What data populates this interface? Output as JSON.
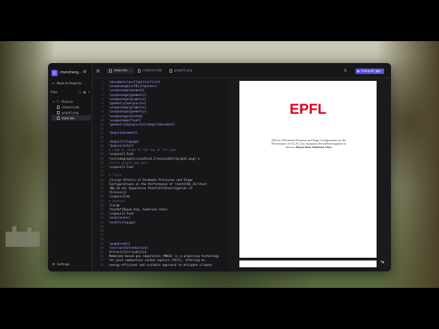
{
  "sidebar": {
    "project_initial": "c",
    "project_name": "chenzheng...",
    "back_label": "Back to Projects",
    "files_label": "Files",
    "tree": [
      {
        "label": "Pictures",
        "type": "folder",
        "indent": false,
        "active": false
      },
      {
        "label": "citations.bib",
        "type": "file",
        "indent": true,
        "active": false
      },
      {
        "label": "graph1.png",
        "type": "file",
        "indent": true,
        "active": false
      },
      {
        "label": "main.tex",
        "type": "file",
        "indent": true,
        "active": true
      }
    ],
    "settings_label": "Settings"
  },
  "tabs": [
    {
      "label": "main.tex",
      "active": true
    },
    {
      "label": "citations.bib",
      "active": false
    },
    {
      "label": "graph1.png",
      "active": false
    }
  ],
  "toolbar": {
    "compile_label": "Compile",
    "compile_shortcut": "⌘S"
  },
  "editor": {
    "lines": [
      {
        "n": "1",
        "text": "\\documentclass[12pt]{article}",
        "kind": "kw"
      },
      {
        "n": "2",
        "text": "\\usepackage[utf8]{inputenc}",
        "kind": "kw"
      },
      {
        "n": "3",
        "text": "\\usepackage{amsmath}",
        "kind": "kw"
      },
      {
        "n": "4",
        "text": "\\usepackage{geometry}",
        "kind": "kw"
      },
      {
        "n": "5",
        "text": "\\usepackage{graphicx}",
        "kind": "kw"
      },
      {
        "n": "6",
        "text": "\\geometry{margin=1in}",
        "kind": "kw"
      },
      {
        "n": "7",
        "text": "\\usepackage{graphicx}",
        "kind": "kw"
      },
      {
        "n": "8",
        "text": "\\usepackage{geometry}",
        "kind": "kw"
      },
      {
        "n": "9",
        "text": "\\usepackage{minted}",
        "kind": "kw"
      },
      {
        "n": "10",
        "text": "\\usepackage{float}",
        "kind": "kw"
      },
      {
        "n": "11",
        "text": "\\geometry{margin=1in}\\begin{document}",
        "kind": "kw"
      },
      {
        "n": "12",
        "text": "",
        "kind": "plain"
      },
      {
        "n": "13",
        "text": "\\begin{document}",
        "kind": "kw"
      },
      {
        "n": "14",
        "text": "",
        "kind": "plain"
      },
      {
        "n": "15",
        "text": "\\begin{titlepage}",
        "kind": "kw"
      },
      {
        "n": "16",
        "text": "    \\begin{center}",
        "kind": "kw"
      },
      {
        "n": "17",
        "text": "        % Logo or image at the top of the page",
        "kind": "cmt"
      },
      {
        "n": "18",
        "text": "        \\vspace{1.5cm}",
        "kind": "plain"
      },
      {
        "n": "19",
        "text": "        \\includegraphics[width=0.5\\textwidth]{graph1.png} %",
        "kind": "plain"
      },
      {
        "n": "20",
        "text": "        insert graph1.png here",
        "kind": "cmt"
      },
      {
        "n": "21",
        "text": "        \\vspace{1.5cm}",
        "kind": "plain"
      },
      {
        "n": "22",
        "text": "",
        "kind": "plain"
      },
      {
        "n": "23",
        "text": "        % Title",
        "kind": "cmt"
      },
      {
        "n": "24",
        "text": "        {\\Large Effects of Permeate Pressures and Stage",
        "kind": "plain"
      },
      {
        "n": "25",
        "text": "        Configurations on the Performance of \\text{CO$_2$/\\text",
        "kind": "plain"
      },
      {
        "n": "26",
        "text": "        {N$_2$ Gas Separation Ptext\\bf{Investigation of",
        "kind": "plain"
      },
      {
        "n": "27",
        "text": "        throcess}}",
        "kind": "plain"
      },
      {
        "n": "28",
        "text": "        \\vspace{2cm}",
        "kind": "plain"
      },
      {
        "n": "29",
        "text": "        % Authors",
        "kind": "cmt"
      },
      {
        "n": "30",
        "text": "        \\large",
        "kind": "plain"
      },
      {
        "n": "31",
        "text": "        \\textbf{Dayon Kim, Anderson Chen}",
        "kind": "plain"
      },
      {
        "n": "32",
        "text": "        \\vspace{1.5cm}",
        "kind": "plain"
      },
      {
        "n": "33",
        "text": "    \\end{center}",
        "kind": "kw"
      },
      {
        "n": "34",
        "text": "\\end{titlepage}",
        "kind": "kw"
      },
      {
        "n": "35",
        "text": "",
        "kind": "plain"
      },
      {
        "n": "36",
        "text": "",
        "kind": "plain"
      },
      {
        "n": "37",
        "text": "",
        "kind": "plain"
      },
      {
        "n": "38",
        "text": "",
        "kind": "plain"
      },
      {
        "n": "39",
        "text": "\\pagebreak{}",
        "kind": "kw"
      },
      {
        "n": "40",
        "text": "\\section{Introduction}",
        "kind": "kw"
      },
      {
        "n": "41",
        "text": "$\\frac{x}{x+\\sum}{i}$",
        "kind": "plain"
      },
      {
        "n": "42",
        "text": "Membrane-based gas separation (MBGS) is a promising technology",
        "kind": "plain"
      },
      {
        "n": "43",
        "text": "for post-combustion carbon capture (PCCC), offering an",
        "kind": "plain"
      },
      {
        "n": "44",
        "text": "energy-efficient and scalable approach to mitigate climate",
        "kind": "plain"
      }
    ]
  },
  "preview": {
    "logo_text": "EPFL",
    "title_line1": "Effects of Permeate Pressures and Stage Configurations on the",
    "title_line2": "Performance of CO₂/N₂ Gas Separation PtextbfInvestigation of",
    "title_line3": "throcess",
    "authors": "Dayon Kim, Anderson Chen"
  },
  "colors": {
    "accent": "#5a4fe0",
    "epfl_red": "#e2001a"
  }
}
